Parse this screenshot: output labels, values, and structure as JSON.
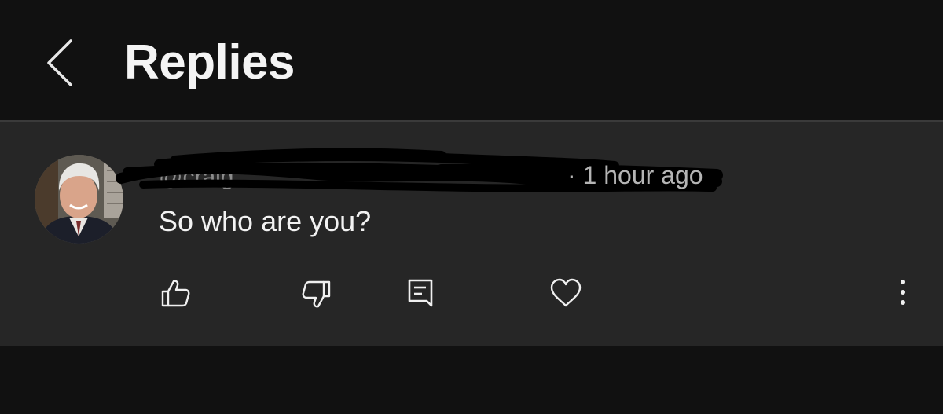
{
  "header": {
    "back_icon": "chevron-left-icon",
    "title": "Replies"
  },
  "comment": {
    "author_handle": "@craig",
    "author_redacted": true,
    "separator": "·",
    "timestamp": "1 hour ago",
    "text": "So who are you?",
    "actions": [
      {
        "name": "like",
        "icon": "thumbs-up-icon"
      },
      {
        "name": "dislike",
        "icon": "thumbs-down-icon"
      },
      {
        "name": "reply",
        "icon": "comment-icon"
      },
      {
        "name": "heart",
        "icon": "heart-icon"
      },
      {
        "name": "more",
        "icon": "more-vertical-icon"
      }
    ]
  },
  "colors": {
    "background": "#111111",
    "card": "#262626",
    "text": "#f2f2f2",
    "secondary_text": "#b5b5b5"
  }
}
